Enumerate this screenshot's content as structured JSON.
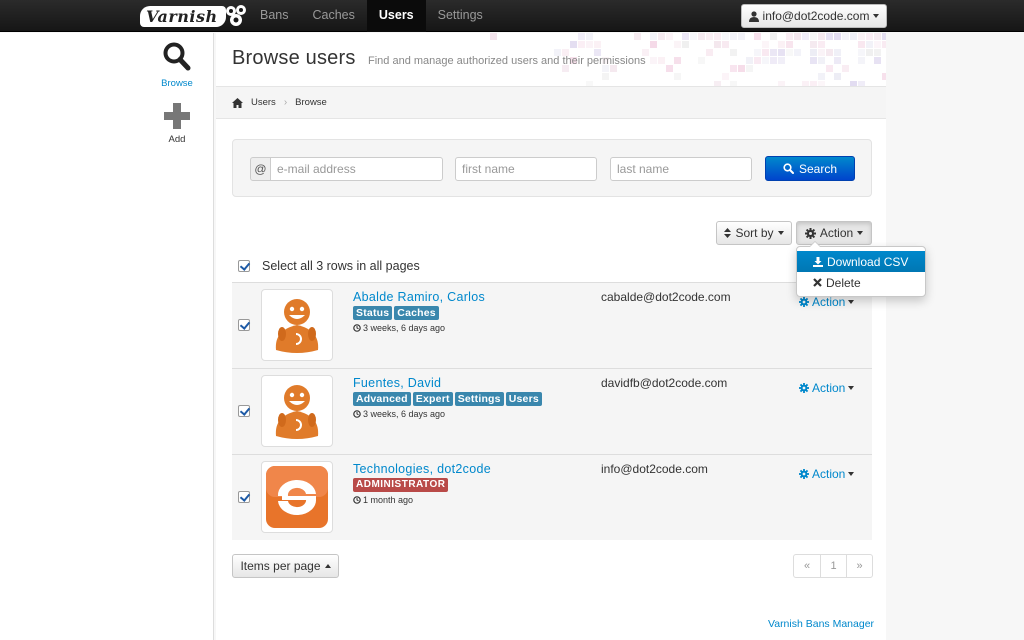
{
  "navbar": {
    "brand": "Varnish",
    "items": [
      {
        "label": "Bans",
        "active": false
      },
      {
        "label": "Caches",
        "active": false
      },
      {
        "label": "Users",
        "active": true
      },
      {
        "label": "Settings",
        "active": false
      }
    ],
    "user": "info@dot2code.com"
  },
  "sidebar": {
    "browse_label": "Browse",
    "add_label": "Add"
  },
  "header": {
    "title": "Browse users",
    "subtitle": "Find and manage authorized users and their permissions"
  },
  "breadcrumb": [
    "Users",
    "Browse"
  ],
  "search": {
    "email_addon": "@",
    "email_placeholder": "e-mail address",
    "first_placeholder": "first name",
    "last_placeholder": "last name",
    "button": "Search"
  },
  "toolbar": {
    "sort_label": "Sort by",
    "action_label": "Action"
  },
  "dropdown": {
    "download": "Download CSV",
    "delete": "Delete"
  },
  "select_all": "Select all 3 rows in all pages",
  "users": [
    {
      "name": "Abalde Ramiro, Carlos",
      "badges": [
        "Status",
        "Caches"
      ],
      "time": "3 weeks, 6 days ago",
      "email": "cabalde@dot2code.com",
      "action": "Action",
      "avatar": "person"
    },
    {
      "name": "Fuentes, David",
      "badges": [
        "Advanced",
        "Expert",
        "Settings",
        "Users"
      ],
      "time": "3 weeks, 6 days ago",
      "email": "davidfb@dot2code.com",
      "action": "Action",
      "avatar": "person"
    },
    {
      "name": "Technologies, dot2code",
      "badges": [],
      "admin_badge": "ADMINISTRATOR",
      "time": "1 month ago",
      "email": "info@dot2code.com",
      "action": "Action",
      "avatar": "logo"
    }
  ],
  "items_per_page": "Items per page",
  "pagination": [
    "«",
    "1",
    "»"
  ],
  "footer": "Varnish Bans Manager",
  "colors": {
    "link": "#0088cc",
    "badge": "#3a87ad",
    "admin_badge": "#b94a48",
    "primary_button": "#0055cc",
    "avatar_orange": "#e07b2a"
  }
}
